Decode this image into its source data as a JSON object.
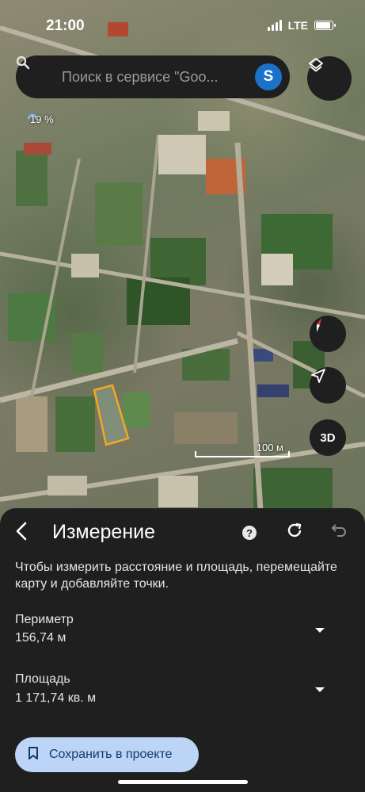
{
  "status_bar": {
    "time": "21:00",
    "network": "LTE"
  },
  "search": {
    "placeholder": "Поиск в сервисе \"Goo...",
    "avatar_letter": "S"
  },
  "map": {
    "loading_text": "19 %",
    "scale_label": "100 м",
    "measured_polygon_color": "#f5a623",
    "three_d_label": "3D",
    "compass_north_color": "#e53935"
  },
  "measurement_sheet": {
    "title": "Измерение",
    "help_symbol": "?",
    "instructions": "Чтобы измерить расстояние и площадь, перемещайте карту и добавляйте точки.",
    "perimeter": {
      "label": "Периметр",
      "value": "156,74 м"
    },
    "area": {
      "label": "Площадь",
      "value": "1 171,74 кв. м"
    },
    "save_button_label": "Сохранить в проекте",
    "icons": {
      "back": "back-arrow-icon",
      "help": "help-icon",
      "refresh": "refresh-icon",
      "undo": "undo-icon",
      "expand": "chevron-down-icon",
      "save": "bookmark-icon"
    }
  },
  "colors": {
    "sheet_background": "#1f1f1f",
    "save_button_background": "#bcd4f5",
    "avatar_background": "#1a73c9"
  }
}
